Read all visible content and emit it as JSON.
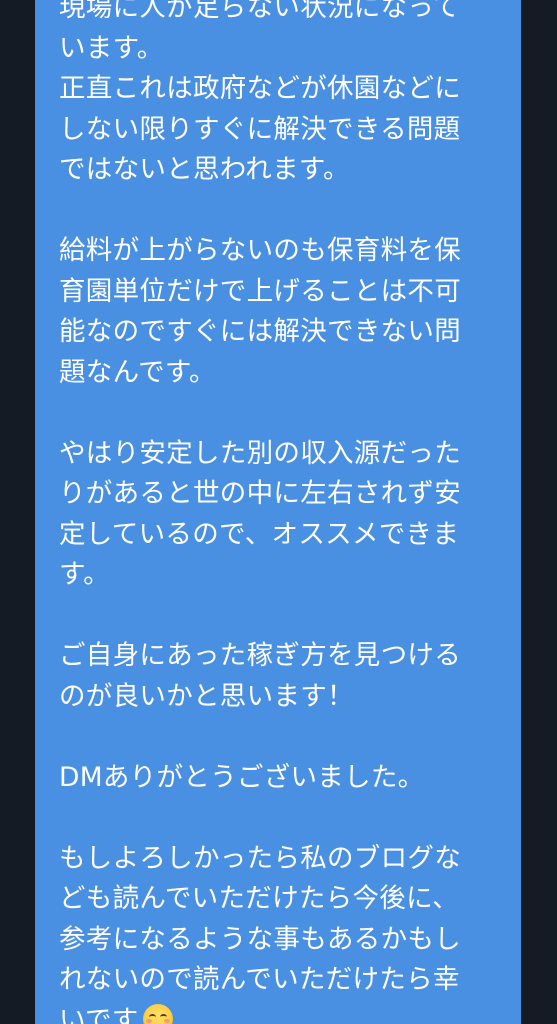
{
  "message": {
    "lines": [
      "現場に人が足らない状況になって",
      "います。",
      "正直これは政府などが休園などに",
      "しない限りすぐに解決できる問題",
      "ではないと思われます。",
      "",
      "給料が上がらないのも保育料を保",
      "育園単位だけで上げることは不可",
      "能なのですぐには解決できない問",
      "題なんです。",
      "",
      "やはり安定した別の収入源だった",
      "りがあると世の中に左右されず安",
      "定しているので、オススメできま",
      "す。",
      "",
      "ご自身にあった稼ぎ方を見つける",
      "のが良いかと思います！",
      "",
      "DMありがとうございました。",
      "",
      "もしよろしかったら私のブログな",
      "ども読んでいただけたら今後に、",
      "参考になるような事もあるかもし",
      "れないので読んでいただけたら幸",
      "いです"
    ],
    "trailing_emoji": "smiling-face-icon"
  }
}
